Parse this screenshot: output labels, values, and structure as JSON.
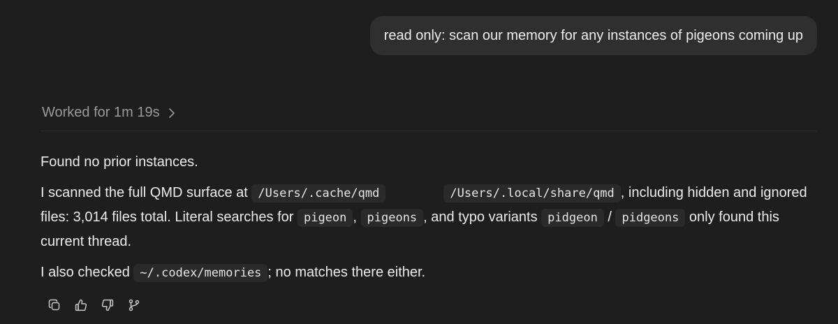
{
  "user_message": "read only: scan our memory for any instances of pigeons coming up",
  "worked": {
    "label": "Worked for 1m 19s",
    "icon": "chevron-right-icon"
  },
  "reply": {
    "p1": "Found no prior instances.",
    "p2": {
      "t1": "I scanned the full QMD surface at ",
      "c1": "/Users/.cache/qmd",
      "c2": "/Users/.local/share/qmd",
      "t2": ", including hidden and ignored files: 3,014 files total. Literal searches for ",
      "c3": "pigeon",
      "t3": ", ",
      "c4": "pigeons",
      "t4": ", and typo variants ",
      "c5": "pidgeon",
      "t5": " / ",
      "c6": "pidgeons",
      "t6": " only found this current thread."
    },
    "p3": {
      "t1": "I also checked ",
      "c1": "~/.codex/memories",
      "t2": "; no matches there either."
    }
  },
  "actions": [
    {
      "icon": "copy-icon"
    },
    {
      "icon": "thumbs-up-icon"
    },
    {
      "icon": "thumbs-down-icon"
    },
    {
      "icon": "branch-icon"
    }
  ],
  "colors": {
    "background": "#1e1e1e",
    "bubble": "#2f2f2f",
    "text": "#ececec",
    "muted": "#9a9a9a",
    "code_bg": "#2a2a2a"
  }
}
